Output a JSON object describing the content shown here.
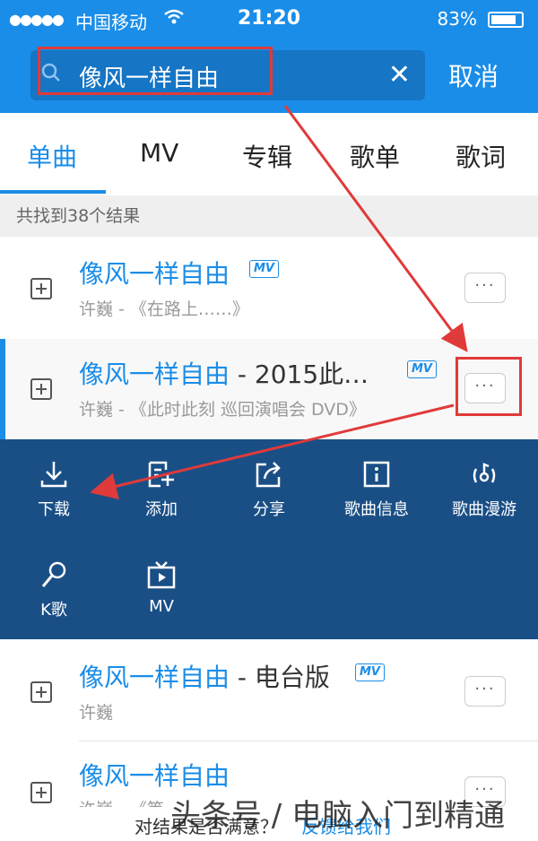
{
  "status": {
    "carrier": "中国移动",
    "time": "21:20",
    "battery": "83%",
    "battery_level": 0.83
  },
  "search": {
    "value": "像风一样自由",
    "cancel_label": "取消",
    "clear_label": "✕"
  },
  "tabs": [
    {
      "label": "单曲",
      "active": true
    },
    {
      "label": "MV"
    },
    {
      "label": "专辑"
    },
    {
      "label": "歌单"
    },
    {
      "label": "歌词"
    }
  ],
  "result_count": "共找到38个结果",
  "results": [
    {
      "title": "像风一样自由",
      "extra": "",
      "mv": "MV",
      "sub": "许巍 - 《在路上……》"
    },
    {
      "title": "像风一样自由",
      "extra": " - 2015此…",
      "mv": "MV",
      "sub": "许巍 - 《此时此刻 巡回演唱会 DVD》"
    },
    {
      "title": "像风一样自由",
      "extra": " - 电台版",
      "mv": "MV",
      "sub": "许巍"
    },
    {
      "title": "像风一样自由",
      "extra": "",
      "mv": "",
      "sub": "许巍 - 《等..."
    }
  ],
  "more_label": "···",
  "actions": [
    {
      "label": "下载",
      "icon": "download-icon"
    },
    {
      "label": "添加",
      "icon": "add-to-list-icon"
    },
    {
      "label": "分享",
      "icon": "share-icon"
    },
    {
      "label": "歌曲信息",
      "icon": "info-icon"
    },
    {
      "label": "歌曲漫游",
      "icon": "song-roam-icon"
    },
    {
      "label": "K歌",
      "icon": "microphone-icon"
    },
    {
      "label": "MV",
      "icon": "tv-icon"
    }
  ],
  "footer": {
    "question": "对结果是否满意？",
    "link": "反馈给我们"
  },
  "watermark": "头条号 / 电脑入门到精通",
  "colors": {
    "brand_blue": "#1a8de8",
    "panel_navy": "#1a4f86",
    "annotation_red": "#e03a3a"
  }
}
